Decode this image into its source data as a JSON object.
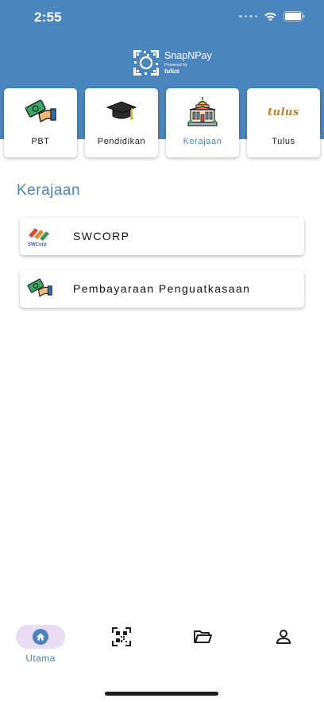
{
  "status_bar": {
    "time": "2:55"
  },
  "brand": {
    "name": "SnapNPay",
    "powered_by": "Powered by",
    "tulus": "tulus"
  },
  "categories": [
    {
      "label": "PBT",
      "icon": "payment-hand-icon",
      "active": false
    },
    {
      "label": "Pendidikan",
      "icon": "graduation-cap-icon",
      "active": false
    },
    {
      "label": "Kerajaan",
      "icon": "government-building-icon",
      "active": true
    },
    {
      "label": "Tulus",
      "icon": "tulus-logo",
      "logo_text": "tulus",
      "active": false
    }
  ],
  "section": {
    "title": "Kerajaan"
  },
  "items": [
    {
      "label": "SWCORP",
      "icon": "swcorp-logo",
      "logo_text": "SWCorp"
    },
    {
      "label": "Pembayaraan Penguatkasaan",
      "icon": "payment-hand-icon"
    }
  ],
  "nav": {
    "items": [
      {
        "label": "Utama",
        "icon": "home-icon",
        "active": true
      },
      {
        "icon": "qr-scan-icon"
      },
      {
        "icon": "folder-open-icon"
      },
      {
        "icon": "person-icon"
      }
    ]
  },
  "colors": {
    "primary": "#4a86bd",
    "active_pill": "#e8ddf3"
  }
}
